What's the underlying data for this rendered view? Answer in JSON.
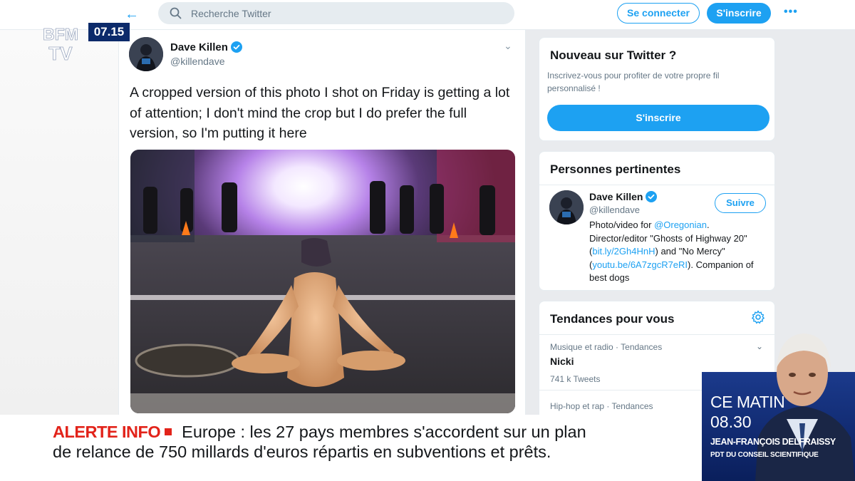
{
  "twitter": {
    "search_placeholder": "Recherche Twitter",
    "login_label": "Se connecter",
    "signup_label": "S'inscrire",
    "more_label": "•••"
  },
  "tweet": {
    "author_name": "Dave Killen",
    "author_handle": "@killendave",
    "text": "A cropped version of this photo I shot on Friday is getting a lot of attention; I don't mind the crop but I do prefer the full version, so I'm putting it here"
  },
  "sidebar": {
    "new_card": {
      "title": "Nouveau sur Twitter ?",
      "description": "Inscrivez-vous pour profiter de votre propre fil personnalisé !",
      "cta_label": "S'inscrire"
    },
    "people_card": {
      "title": "Personnes pertinentes",
      "name": "Dave Killen",
      "handle": "@killendave",
      "follow_label": "Suivre",
      "bio_part1": "Photo/video for ",
      "bio_link1": "@Oregonian",
      "bio_part2": ". Director/editor \"Ghosts of Highway 20\" (",
      "bio_link2": "bit.ly/2Gh4HnH",
      "bio_part3": ") and \"No Mercy\" (",
      "bio_link3": "youtu.be/6A7zgcR7eRI",
      "bio_part4": "). Companion of best dogs"
    },
    "trends_card": {
      "title": "Tendances pour vous",
      "trends": [
        {
          "meta": "Musique et radio · Tendances",
          "name": "Nicki",
          "count": "741 k Tweets"
        },
        {
          "meta": "Hip-hop et rap · Tendances"
        }
      ]
    }
  },
  "broadcast": {
    "channel_logo": "BFM TV",
    "clock": "07.15",
    "alert_label": "ALERTE INFO",
    "headline_line1": "Europe : les 27 pays membres s'accordent sur un plan",
    "headline_line2": "de relance de 750 millards d'euros répartis en subventions et prêts.",
    "program_title": "CE MATIN",
    "program_time": "08.30",
    "guest_name": "JEAN-FRANÇOIS DELFRAISSY",
    "guest_role": "PDT DU CONSEIL SCIENTIFIQUE"
  },
  "colors": {
    "twitter_blue": "#1da1f2",
    "alert_red": "#e2231a",
    "bfm_navy": "#0c2a6a"
  }
}
